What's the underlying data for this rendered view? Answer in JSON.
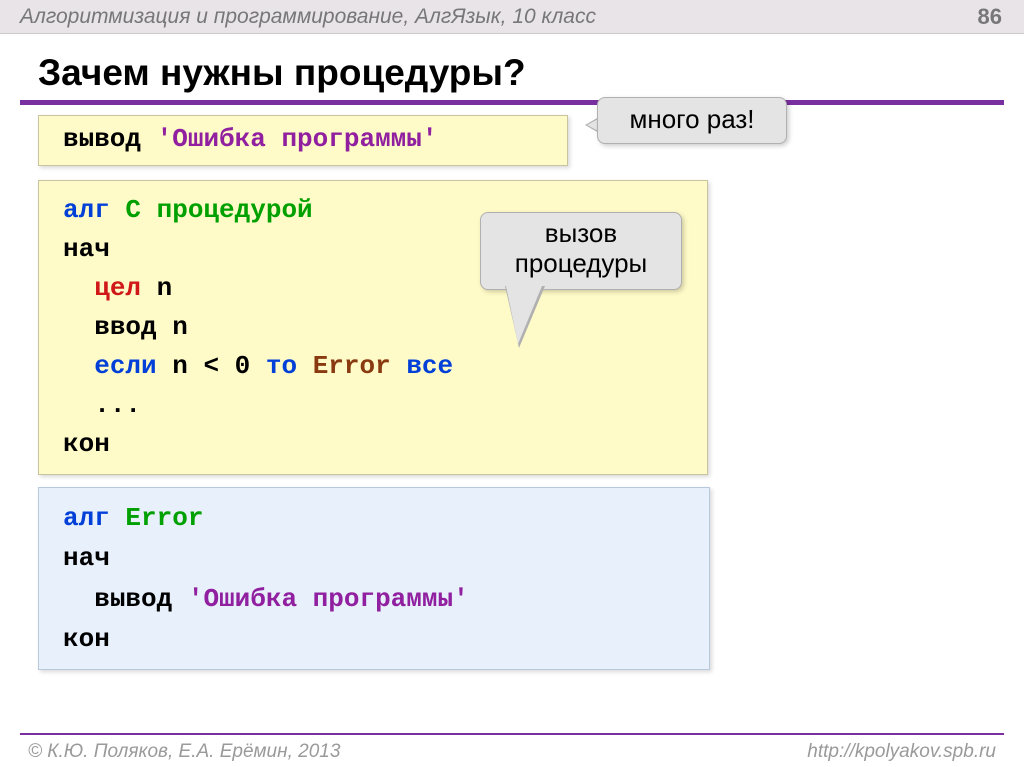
{
  "header": {
    "title": "Алгоритмизация и программирование, АлгЯзык, 10 класс",
    "page_number": "86"
  },
  "main_title": "Зачем нужны процедуры?",
  "callouts": {
    "many_times": "много раз!",
    "procedure_call_line1": "вызов",
    "procedure_call_line2": "процедуры"
  },
  "code1": {
    "vyvod": "вывод ",
    "str_open": "'",
    "str_text": "Ошибка программы",
    "str_close": "'"
  },
  "code2": {
    "l1_alg": "алг ",
    "l1_name": "С процедурой",
    "l2_nach": "нач",
    "l3_pad": "  ",
    "l3_cel": "цел",
    "l3_n": " n",
    "l4_pad": "  ",
    "l4_vvod": "ввод",
    "l4_n": " n",
    "l5_pad": "  ",
    "l5_esli": "если",
    "l5_cond": " n < 0 ",
    "l5_to": "то",
    "l5_sp": " ",
    "l5_error": "Error",
    "l5_sp2": " ",
    "l5_vse": "все",
    "l6_pad": "  ",
    "l6_dots": "...",
    "l7_kon": "кон"
  },
  "code3": {
    "l1_alg": "алг ",
    "l1_error": "Error",
    "l2_nach": "нач",
    "l3_pad": "  ",
    "l3_vyvod": "вывод ",
    "l3_q1": "'",
    "l3_text": "Ошибка программы",
    "l3_q2": "'",
    "l4_kon": "кон"
  },
  "footer": {
    "copyright": "© К.Ю. Поляков, Е.А. Ерёмин, 2013",
    "url": "http://kpolyakov.spb.ru"
  }
}
